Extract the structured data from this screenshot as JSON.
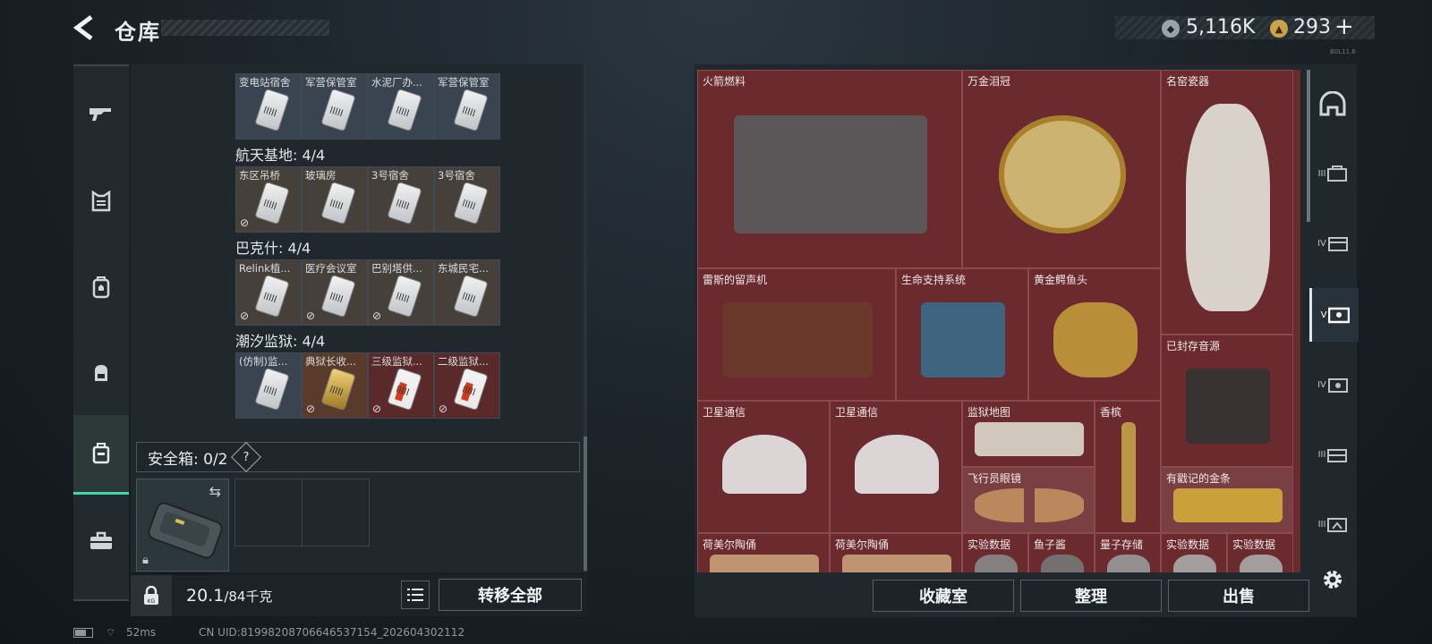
{
  "header": {
    "title": "仓库",
    "currency1": "5,116K",
    "currency2": "293",
    "currency2_add": "+",
    "version": "B0L11.6"
  },
  "left_nav": [
    "weapon-icon",
    "armor-icon",
    "backpack-icon",
    "chest-rig-icon",
    "safebox-icon",
    "toolbox-icon"
  ],
  "key_groups": [
    {
      "title": "",
      "keys": [
        {
          "label": "变电站宿舍",
          "style": "silver",
          "locked": false
        },
        {
          "label": "军营保管室",
          "style": "silver",
          "locked": false
        },
        {
          "label": "水泥厂办...",
          "style": "silver",
          "locked": false
        },
        {
          "label": "军营保管室",
          "style": "silver",
          "locked": false
        }
      ]
    },
    {
      "title": "航天基地: 4/4",
      "keys": [
        {
          "label": "东区吊桥",
          "style": "silver",
          "locked": true
        },
        {
          "label": "玻璃房",
          "style": "silver",
          "locked": false
        },
        {
          "label": "3号宿舍",
          "style": "silver",
          "locked": false
        },
        {
          "label": "3号宿舍",
          "style": "silver",
          "locked": false
        }
      ]
    },
    {
      "title": "巴克什: 4/4",
      "keys": [
        {
          "label": "Relink植...",
          "style": "silver",
          "locked": true
        },
        {
          "label": "医疗会议室",
          "style": "silver",
          "locked": true
        },
        {
          "label": "巴别塔供...",
          "style": "silver",
          "locked": true
        },
        {
          "label": "东城民宅...",
          "style": "silver",
          "locked": false
        }
      ]
    },
    {
      "title": "潮汐监狱: 4/4",
      "keys": [
        {
          "label": "(仿制)监...",
          "style": "silver",
          "locked": false
        },
        {
          "label": "典狱长收...",
          "style": "gold",
          "locked": true
        },
        {
          "label": "三级监狱...",
          "style": "red",
          "locked": true
        },
        {
          "label": "二级监狱...",
          "style": "red",
          "locked": true
        }
      ]
    }
  ],
  "safebox": {
    "title": "安全箱: 0/2",
    "help": "?"
  },
  "weight": {
    "value": "20.1",
    "max": "/84千克"
  },
  "buttons": {
    "transfer_all": "转移全部",
    "collection": "收藏室",
    "sort": "整理",
    "sell": "出售"
  },
  "stash_items": [
    "火箭燃料",
    "万金泪冠",
    "名窑瓷器",
    "雷斯的留声机",
    "生命支持系统",
    "黄金鳄鱼头",
    "已封存音源",
    "卫星通信",
    "卫星通信",
    "监狱地图",
    "香槟",
    "飞行员眼镜",
    "有戳记的金条",
    "荷美尔陶俑",
    "荷美尔陶俑",
    "实验数据",
    "鱼子酱",
    "量子存储",
    "实验数据",
    "实验数据"
  ],
  "right_nav": [
    "helmet-icon",
    "III",
    "IV",
    "V",
    "IV",
    "III",
    "III"
  ],
  "status": {
    "ping": "52ms",
    "uid": "CN UID:8199820870664653715​4_202604302112"
  }
}
